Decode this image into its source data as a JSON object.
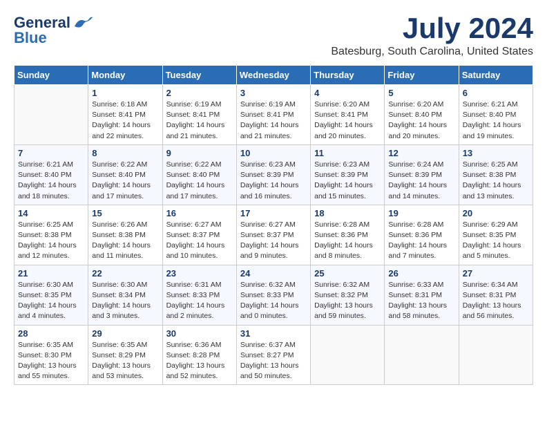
{
  "logo": {
    "general": "General",
    "blue": "Blue",
    "tagline": ""
  },
  "header": {
    "month": "July 2024",
    "location": "Batesburg, South Carolina, United States"
  },
  "weekdays": [
    "Sunday",
    "Monday",
    "Tuesday",
    "Wednesday",
    "Thursday",
    "Friday",
    "Saturday"
  ],
  "weeks": [
    [
      {
        "day": "",
        "info": ""
      },
      {
        "day": "1",
        "info": "Sunrise: 6:18 AM\nSunset: 8:41 PM\nDaylight: 14 hours\nand 22 minutes."
      },
      {
        "day": "2",
        "info": "Sunrise: 6:19 AM\nSunset: 8:41 PM\nDaylight: 14 hours\nand 21 minutes."
      },
      {
        "day": "3",
        "info": "Sunrise: 6:19 AM\nSunset: 8:41 PM\nDaylight: 14 hours\nand 21 minutes."
      },
      {
        "day": "4",
        "info": "Sunrise: 6:20 AM\nSunset: 8:41 PM\nDaylight: 14 hours\nand 20 minutes."
      },
      {
        "day": "5",
        "info": "Sunrise: 6:20 AM\nSunset: 8:40 PM\nDaylight: 14 hours\nand 20 minutes."
      },
      {
        "day": "6",
        "info": "Sunrise: 6:21 AM\nSunset: 8:40 PM\nDaylight: 14 hours\nand 19 minutes."
      }
    ],
    [
      {
        "day": "7",
        "info": "Sunrise: 6:21 AM\nSunset: 8:40 PM\nDaylight: 14 hours\nand 18 minutes."
      },
      {
        "day": "8",
        "info": "Sunrise: 6:22 AM\nSunset: 8:40 PM\nDaylight: 14 hours\nand 17 minutes."
      },
      {
        "day": "9",
        "info": "Sunrise: 6:22 AM\nSunset: 8:40 PM\nDaylight: 14 hours\nand 17 minutes."
      },
      {
        "day": "10",
        "info": "Sunrise: 6:23 AM\nSunset: 8:39 PM\nDaylight: 14 hours\nand 16 minutes."
      },
      {
        "day": "11",
        "info": "Sunrise: 6:23 AM\nSunset: 8:39 PM\nDaylight: 14 hours\nand 15 minutes."
      },
      {
        "day": "12",
        "info": "Sunrise: 6:24 AM\nSunset: 8:39 PM\nDaylight: 14 hours\nand 14 minutes."
      },
      {
        "day": "13",
        "info": "Sunrise: 6:25 AM\nSunset: 8:38 PM\nDaylight: 14 hours\nand 13 minutes."
      }
    ],
    [
      {
        "day": "14",
        "info": "Sunrise: 6:25 AM\nSunset: 8:38 PM\nDaylight: 14 hours\nand 12 minutes."
      },
      {
        "day": "15",
        "info": "Sunrise: 6:26 AM\nSunset: 8:38 PM\nDaylight: 14 hours\nand 11 minutes."
      },
      {
        "day": "16",
        "info": "Sunrise: 6:27 AM\nSunset: 8:37 PM\nDaylight: 14 hours\nand 10 minutes."
      },
      {
        "day": "17",
        "info": "Sunrise: 6:27 AM\nSunset: 8:37 PM\nDaylight: 14 hours\nand 9 minutes."
      },
      {
        "day": "18",
        "info": "Sunrise: 6:28 AM\nSunset: 8:36 PM\nDaylight: 14 hours\nand 8 minutes."
      },
      {
        "day": "19",
        "info": "Sunrise: 6:28 AM\nSunset: 8:36 PM\nDaylight: 14 hours\nand 7 minutes."
      },
      {
        "day": "20",
        "info": "Sunrise: 6:29 AM\nSunset: 8:35 PM\nDaylight: 14 hours\nand 5 minutes."
      }
    ],
    [
      {
        "day": "21",
        "info": "Sunrise: 6:30 AM\nSunset: 8:35 PM\nDaylight: 14 hours\nand 4 minutes."
      },
      {
        "day": "22",
        "info": "Sunrise: 6:30 AM\nSunset: 8:34 PM\nDaylight: 14 hours\nand 3 minutes."
      },
      {
        "day": "23",
        "info": "Sunrise: 6:31 AM\nSunset: 8:33 PM\nDaylight: 14 hours\nand 2 minutes."
      },
      {
        "day": "24",
        "info": "Sunrise: 6:32 AM\nSunset: 8:33 PM\nDaylight: 14 hours\nand 0 minutes."
      },
      {
        "day": "25",
        "info": "Sunrise: 6:32 AM\nSunset: 8:32 PM\nDaylight: 13 hours\nand 59 minutes."
      },
      {
        "day": "26",
        "info": "Sunrise: 6:33 AM\nSunset: 8:31 PM\nDaylight: 13 hours\nand 58 minutes."
      },
      {
        "day": "27",
        "info": "Sunrise: 6:34 AM\nSunset: 8:31 PM\nDaylight: 13 hours\nand 56 minutes."
      }
    ],
    [
      {
        "day": "28",
        "info": "Sunrise: 6:35 AM\nSunset: 8:30 PM\nDaylight: 13 hours\nand 55 minutes."
      },
      {
        "day": "29",
        "info": "Sunrise: 6:35 AM\nSunset: 8:29 PM\nDaylight: 13 hours\nand 53 minutes."
      },
      {
        "day": "30",
        "info": "Sunrise: 6:36 AM\nSunset: 8:28 PM\nDaylight: 13 hours\nand 52 minutes."
      },
      {
        "day": "31",
        "info": "Sunrise: 6:37 AM\nSunset: 8:27 PM\nDaylight: 13 hours\nand 50 minutes."
      },
      {
        "day": "",
        "info": ""
      },
      {
        "day": "",
        "info": ""
      },
      {
        "day": "",
        "info": ""
      }
    ]
  ]
}
